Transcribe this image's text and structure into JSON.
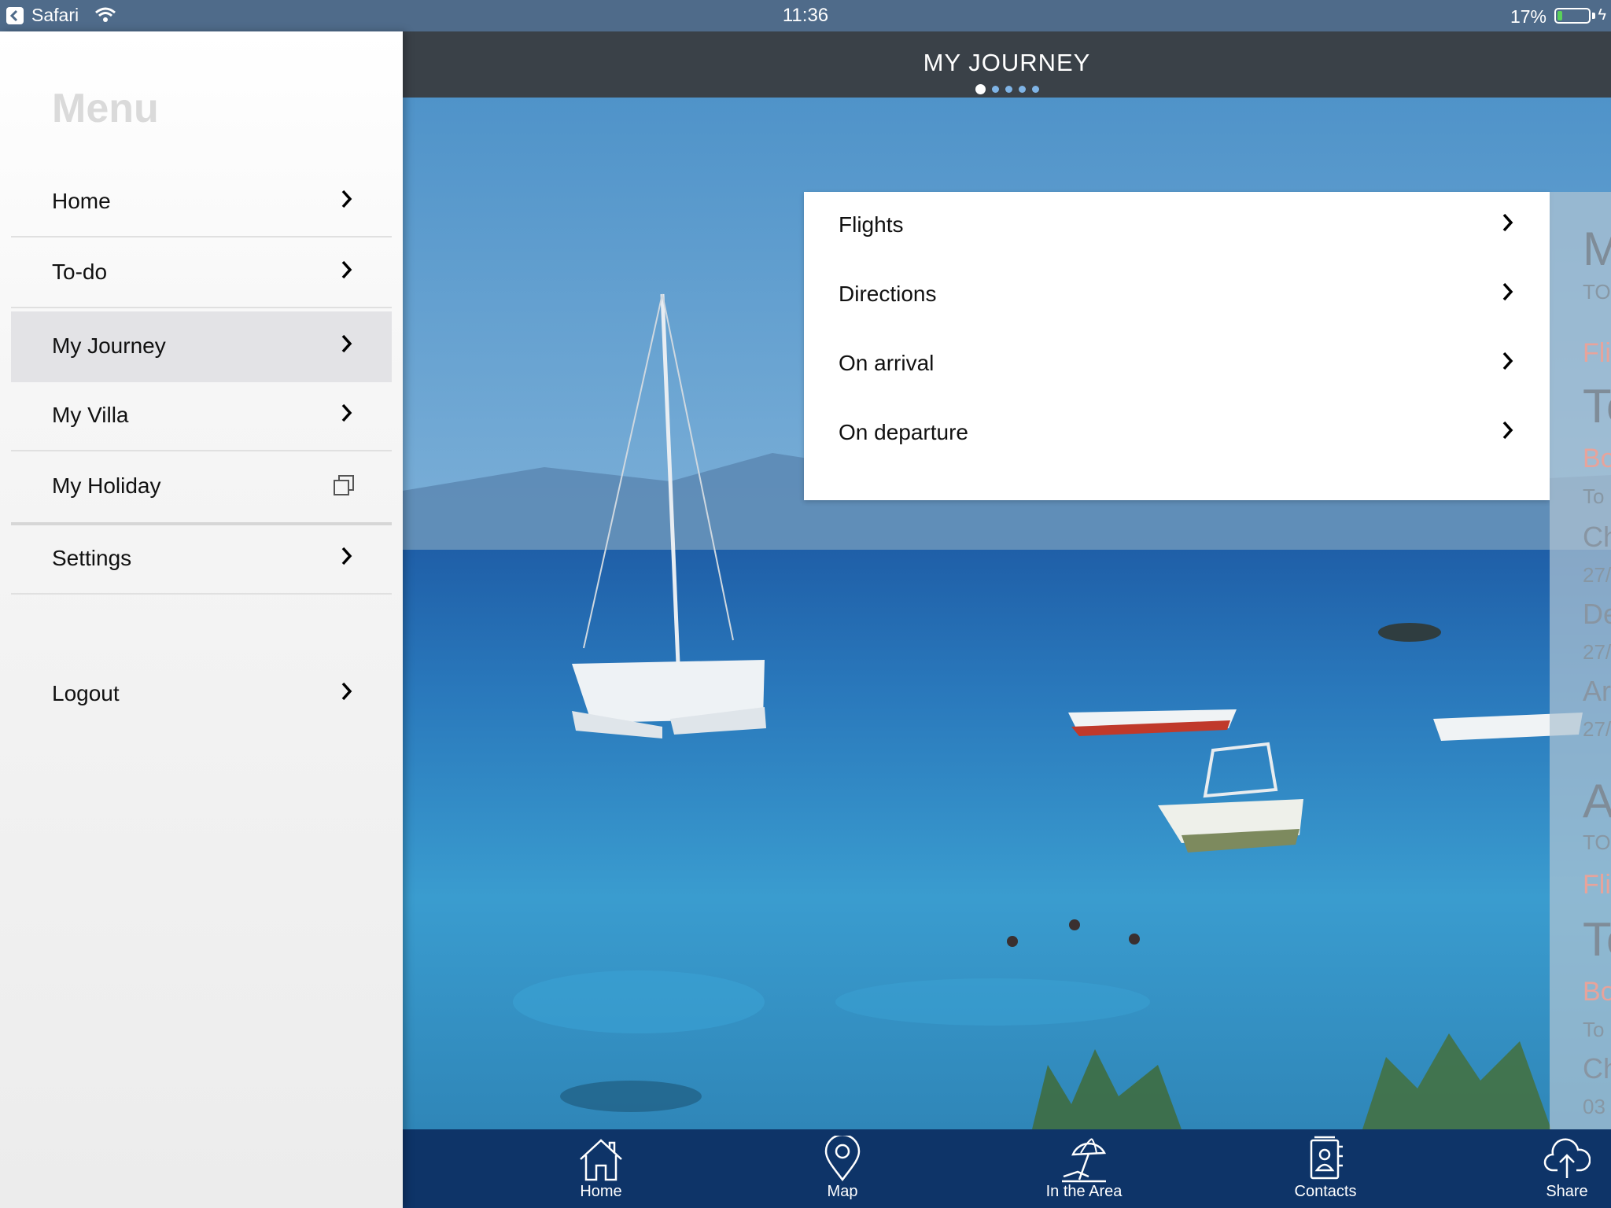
{
  "status_bar": {
    "app": "Safari",
    "time": "11:36",
    "battery_percent_text": "17%",
    "battery_level": 0.17
  },
  "sidebar": {
    "title": "Menu",
    "items": [
      {
        "label": "Home",
        "icon": "chevron-right-icon",
        "active": false
      },
      {
        "label": "To-do",
        "icon": "chevron-right-icon",
        "active": false
      },
      {
        "label": "My Journey",
        "icon": "chevron-right-icon",
        "active": true
      },
      {
        "label": "My Villa",
        "icon": "chevron-right-icon",
        "active": false
      },
      {
        "label": "My Holiday",
        "icon": "external-window-icon",
        "active": false
      },
      {
        "label": "Settings",
        "icon": "chevron-right-icon",
        "active": false
      }
    ],
    "logout_label": "Logout"
  },
  "header": {
    "title": "MY JOURNEY",
    "page_count": 5,
    "current_page": 1
  },
  "submenu": {
    "items": [
      {
        "label": "Flights"
      },
      {
        "label": "Directions"
      },
      {
        "label": "On arrival"
      },
      {
        "label": "On departure"
      }
    ]
  },
  "peek_panel": {
    "lines": [
      "M",
      "TO",
      "Fli",
      "To",
      "Bo",
      "To",
      "Ch",
      "27/",
      "De",
      "27/",
      "Ar",
      "27/",
      "A",
      "TO",
      "Fli",
      "To",
      "Bo",
      "To",
      "Ch",
      "03"
    ]
  },
  "tabbar": {
    "tabs": [
      {
        "label": "Home",
        "icon": "home-icon"
      },
      {
        "label": "Map",
        "icon": "map-pin-icon"
      },
      {
        "label": "In the Area",
        "icon": "beach-umbrella-icon"
      },
      {
        "label": "Contacts",
        "icon": "contacts-book-icon"
      },
      {
        "label": "Share",
        "icon": "cloud-upload-icon"
      }
    ]
  },
  "colors": {
    "status_bar": "#4f6b8a",
    "header": "#3a4148",
    "tabbar": "#0e3468",
    "active_menu": "#e3e3e6",
    "battery_fill": "#5ad15a"
  }
}
